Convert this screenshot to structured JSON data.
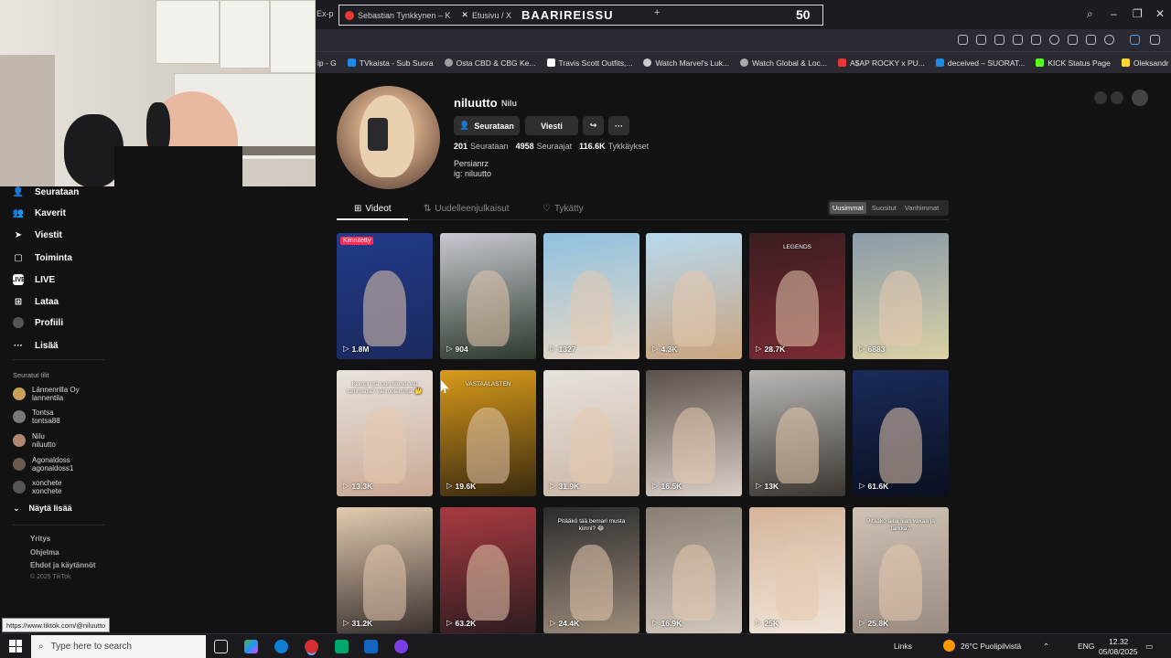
{
  "browser": {
    "partial_tab_label": "Ex-p",
    "tabs": [
      {
        "label": "Sebastian Tynkkynen – K",
        "icon": "red-circle-icon"
      },
      {
        "label": "Etusivu / X",
        "icon": "x-logo-icon"
      }
    ],
    "new_tab": "+",
    "overlay_title": "BAARIREISSU",
    "overlay_number": "50",
    "bookmarks": [
      {
        "label": "ip - G"
      },
      {
        "label": "TVkaista - Sub Suora"
      },
      {
        "label": "Osta CBD & CBG Ke..."
      },
      {
        "label": "Travis Scott Outfits,..."
      },
      {
        "label": "Watch Marvel's Luk..."
      },
      {
        "label": "Watch Global & Loc..."
      },
      {
        "label": "A$AP ROCKY x PU..."
      },
      {
        "label": "deceived – SUORAT..."
      },
      {
        "label": "KICK Status Page"
      },
      {
        "label": "Oleksandr Usyk vs D..."
      }
    ]
  },
  "sidebar": {
    "nav": [
      {
        "label": "Seurataan",
        "icon": "user-follow-icon"
      },
      {
        "label": "Kaverit",
        "icon": "friends-icon"
      },
      {
        "label": "Viestit",
        "icon": "send-icon"
      },
      {
        "label": "Toiminta",
        "icon": "inbox-icon"
      },
      {
        "label": "LIVE",
        "icon": "live-icon"
      },
      {
        "label": "Lataa",
        "icon": "upload-icon"
      },
      {
        "label": "Profiili",
        "icon": "profile-icon"
      },
      {
        "label": "Lisää",
        "icon": "more-icon"
      }
    ],
    "following_header": "Seuratut tilit",
    "following": [
      {
        "name": "Lännenrilla Oy",
        "handle": "lannentila"
      },
      {
        "name": "Tontsa",
        "handle": "tontsa88"
      },
      {
        "name": "Nilu",
        "handle": "niluutto"
      },
      {
        "name": "Agonaldoss",
        "handle": "agonaldoss1"
      },
      {
        "name": "xonchete",
        "handle": "xonchete"
      }
    ],
    "show_more": "Näytä lisää",
    "footer": [
      "Yritys",
      "Ohjelma",
      "Ehdot ja käytännöt",
      "© 2025 TikTok"
    ]
  },
  "profile": {
    "username": "niluutto",
    "nickname": "Nilu",
    "follow_label": "Seurataan",
    "message_label": "Viesti",
    "stats": [
      {
        "value": "201",
        "label": "Seurataan"
      },
      {
        "value": "4958",
        "label": "Seuraajat"
      },
      {
        "value": "116.6K",
        "label": "Tykkäykset"
      }
    ],
    "bio": [
      "Persianrz",
      "ig: niluutto"
    ]
  },
  "tabs": [
    {
      "label": "Videot",
      "active": true
    },
    {
      "label": "Uudelleenjulkaisut",
      "active": false
    },
    {
      "label": "Tykätty",
      "active": false
    }
  ],
  "sort": [
    "Uusimmat",
    "Suositut",
    "Vanhimmat"
  ],
  "videos": [
    {
      "views": "1.8M",
      "badge": "Kiinnitetty",
      "caption": ""
    },
    {
      "views": "904",
      "badge": "",
      "caption": ""
    },
    {
      "views": "1327",
      "badge": "",
      "caption": ""
    },
    {
      "views": "4.3K",
      "badge": "",
      "caption": ""
    },
    {
      "views": "28.7K",
      "badge": "",
      "caption": "LEGENDS"
    },
    {
      "views": "6883",
      "badge": "",
      "caption": ""
    },
    {
      "views": "13.3K",
      "badge": "",
      "caption": "Kumpi mä oon blondi vai tummana? vai molemmat 🤔"
    },
    {
      "views": "19.6K",
      "badge": "",
      "caption": "VASTAALASTEN"
    },
    {
      "views": "31.9K",
      "badge": "",
      "caption": ""
    },
    {
      "views": "16.5K",
      "badge": "",
      "caption": ""
    },
    {
      "views": "13K",
      "badge": "",
      "caption": ""
    },
    {
      "views": "61.6K",
      "badge": "",
      "caption": ""
    },
    {
      "views": "31.2K",
      "badge": "",
      "caption": ""
    },
    {
      "views": "63.2K",
      "badge": "",
      "caption": ""
    },
    {
      "views": "24.4K",
      "badge": "",
      "caption": "Pitääkö tää bemari musta kiinni? 😂"
    },
    {
      "views": "16.9K",
      "badge": "",
      "caption": ""
    },
    {
      "views": "25K",
      "badge": "",
      "caption": ""
    },
    {
      "views": "25.8K",
      "badge": "",
      "caption": "Pitääkö äitiä liian vakaa ja tarkka?"
    }
  ],
  "status_url": "https://www.tiktok.com/@niluutto",
  "taskbar": {
    "search_placeholder": "Type here to search",
    "weather": "26°C  Puolipilvistä",
    "links": "Links",
    "lang": "ENG",
    "time": "12.32",
    "date": "05/08/2025"
  },
  "colors": {
    "accent": "#fe2c55",
    "bg": "#121212"
  }
}
